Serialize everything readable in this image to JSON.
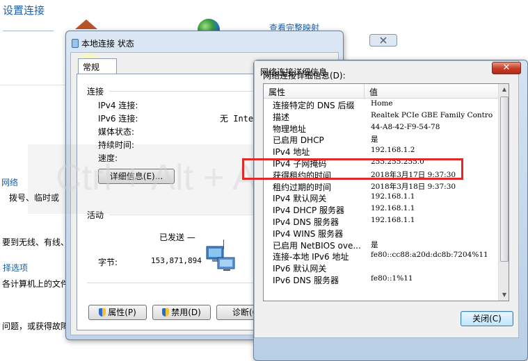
{
  "background": {
    "title": "设置连接",
    "link": "查看完整映射",
    "fragments": [
      "网络",
      "拨号、临时或",
      "要到无线、有线、",
      "择选项",
      "各计算机上的文件",
      "问题，或获得故障"
    ]
  },
  "watermark": {
    "text": "Ctrl + Alt + A"
  },
  "status_window": {
    "title": "本地连接 状态",
    "close_glyph": "✕",
    "tab": "常规",
    "connection_heading": "连接",
    "rows": [
      {
        "label": "IPv4 连接:",
        "value": ""
      },
      {
        "label": "IPv6 连接:",
        "value": "无 Inter"
      },
      {
        "label": "媒体状态:",
        "value": ""
      },
      {
        "label": "持续时间:",
        "value": ""
      },
      {
        "label": "速度:",
        "value": ""
      }
    ],
    "details_button": "详细信息(E)...",
    "activity_heading": "活动",
    "sent_label": "已发送 —",
    "bytes_label": "字节:",
    "bytes_sent": "153,871,894",
    "buttons": {
      "properties": "属性(P)",
      "disable": "禁用(D)",
      "diagnose": "诊断(G"
    }
  },
  "details_window": {
    "title": "网络连接详细信息",
    "close_glyph": "✕",
    "caption": "网络连接详细信息(D):",
    "columns": {
      "property": "属性",
      "value": "值"
    },
    "rows": [
      {
        "property": "连接特定的 DNS 后缀",
        "value": "Home"
      },
      {
        "property": "描述",
        "value": "Realtek PCIe GBE Family Contro"
      },
      {
        "property": "物理地址",
        "value": "44-A8-42-F9-54-78"
      },
      {
        "property": "已启用 DHCP",
        "value": "是"
      },
      {
        "property": "IPv4 地址",
        "value": "192.168.1.2"
      },
      {
        "property": "IPv4 子网掩码",
        "value": "255.255.255.0"
      },
      {
        "property": "获得租约的时间",
        "value": "2018年3月17日 9:37:30"
      },
      {
        "property": "租约过期的时间",
        "value": "2018年3月18日 9:37:30"
      },
      {
        "property": "IPv4 默认网关",
        "value": "192.168.1.1"
      },
      {
        "property": "IPv4 DHCP 服务器",
        "value": "192.168.1.1"
      },
      {
        "property": "IPv4 DNS 服务器",
        "value": "192.168.1.1"
      },
      {
        "property": "IPv4 WINS 服务器",
        "value": ""
      },
      {
        "property": "已启用 NetBIOS ove...",
        "value": "是"
      },
      {
        "property": "连接-本地 IPv6 地址",
        "value": "fe80::cc88:a20d:dc8b:7204%11"
      },
      {
        "property": "IPv6 默认网关",
        "value": ""
      },
      {
        "property": "IPv6 DNS 服务器",
        "value": "fe80::1%11"
      }
    ],
    "close_button": "关闭(C)",
    "highlighted_row": "IPv4 地址",
    "highlight_color": "#e02a2a"
  }
}
